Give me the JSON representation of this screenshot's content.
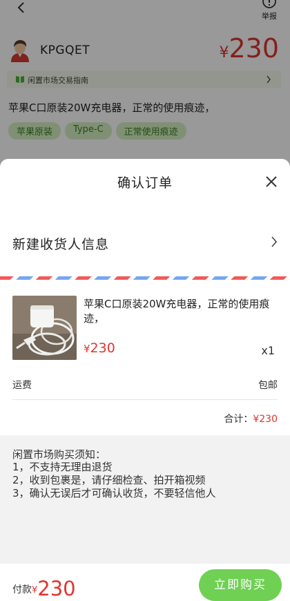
{
  "background_page": {
    "report_label": "举报",
    "seller_name": "KPGQET",
    "price_currency": "¥",
    "price_value": "230",
    "guide_text": "闲置市场交易指南",
    "title": "苹果C口原装20W充电器，正常的使用痕迹，",
    "tags": [
      "苹果原装",
      "Type-C",
      "正常使用痕迹"
    ]
  },
  "sheet": {
    "title": "确认订单",
    "address_label": "新建收货人信息",
    "product": {
      "title": "苹果C口原装20W充电器，正常的使用痕迹，",
      "price_currency": "¥",
      "price_value": "230",
      "quantity": "x1"
    },
    "shipping_label": "运费",
    "shipping_value": "包邮",
    "total_label": "合计：",
    "total_value": "¥230",
    "notice": {
      "title": "闲置市场购买须知：",
      "items": [
        "1，不支持无理由退货",
        "2，收到包裹是，请仔细检查、拍开箱视频",
        "3，确认无误后才可确认收货，不要轻信他人"
      ]
    },
    "footer": {
      "pay_label": "付款",
      "pay_currency": "¥",
      "pay_amount": "230",
      "buy_label": "立即购买"
    }
  },
  "colors": {
    "price_red": "#e03530",
    "buy_green": "#6fd054",
    "tag_green_bg": "#d6f1c2",
    "tag_green_text": "#3b7f24",
    "airmail_red": "#f25a5a",
    "airmail_blue": "#74a7f2"
  },
  "icons": [
    "back-arrow-icon",
    "report-icon",
    "avatar",
    "book-icon",
    "chevron-right-icon",
    "close-icon"
  ]
}
